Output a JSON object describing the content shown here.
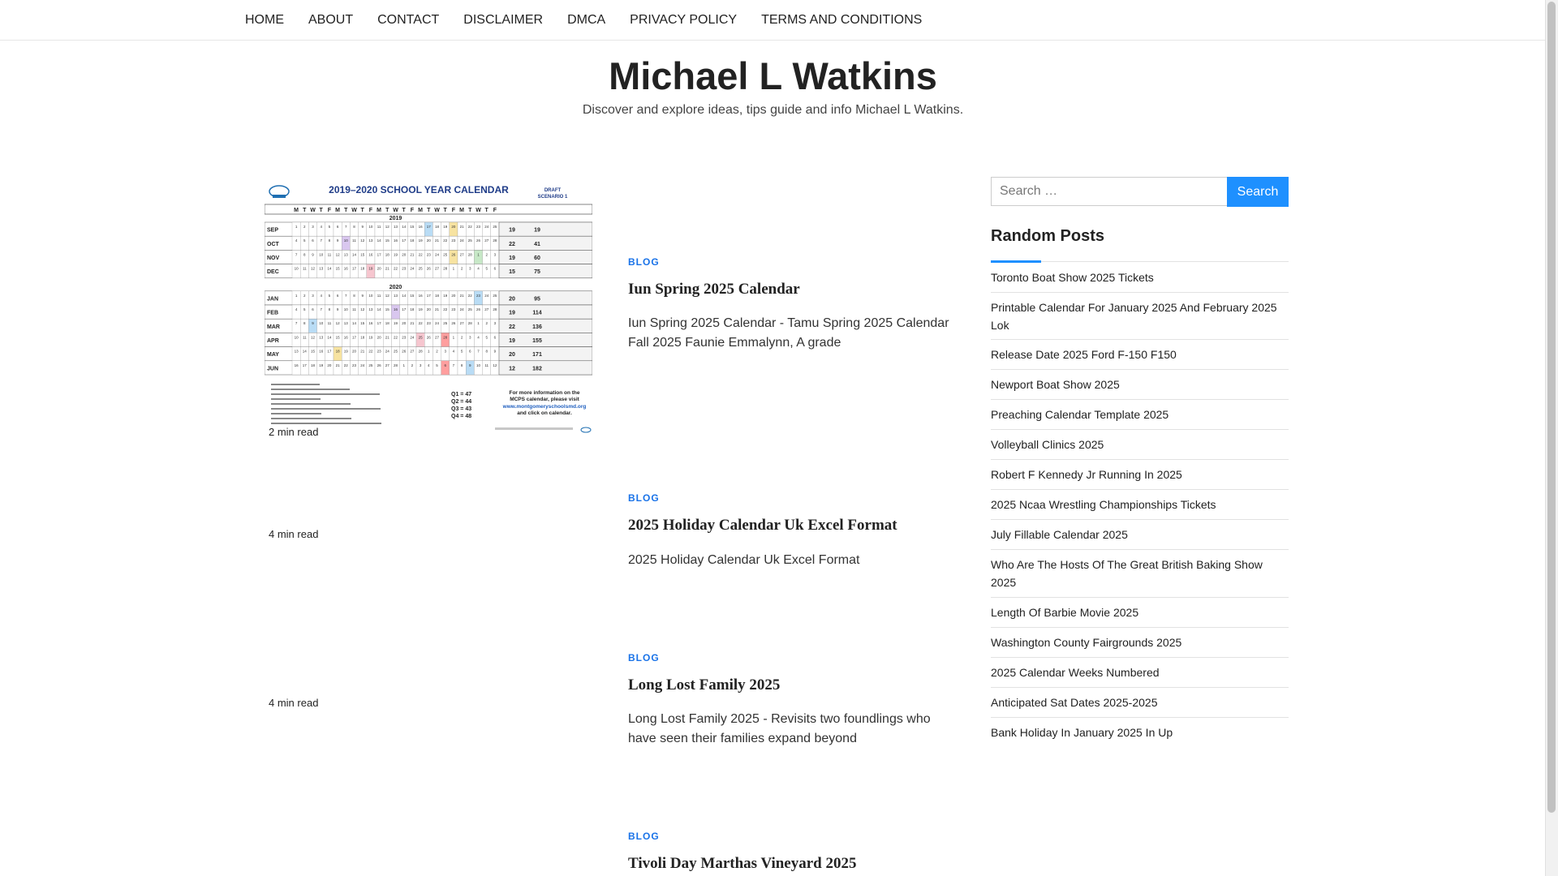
{
  "nav": {
    "items": [
      "HOME",
      "ABOUT",
      "CONTACT",
      "DISCLAIMER",
      "DMCA",
      "PRIVACY POLICY",
      "TERMS AND CONDITIONS"
    ]
  },
  "header": {
    "title": "Michael L Watkins",
    "description": "Discover and explore ideas, tips guide and info Michael L Watkins."
  },
  "posts": [
    {
      "category": "BLOG",
      "title": "Iun Spring 2025 Calendar",
      "excerpt": "Iun Spring 2025 Calendar - Tamu Spring 2025 Calendar Fall 2025 Faunie Emmalynn, A grade",
      "read_time": "2 min read"
    },
    {
      "category": "BLOG",
      "title": "2025 Holiday Calendar Uk Excel Format",
      "excerpt": "2025 Holiday Calendar Uk Excel Format",
      "read_time": "4 min read"
    },
    {
      "category": "BLOG",
      "title": "Long Lost Family 2025",
      "excerpt": "Long Lost Family 2025 - Revisits two foundlings who have seen their families expand beyond",
      "read_time": "4 min read"
    },
    {
      "category": "BLOG",
      "title": "Tivoli Day Marthas Vineyard 2025"
    }
  ],
  "thumbnail": {
    "heading": "2019–2020 SCHOOL YEAR CALENDAR",
    "draft": "DRAFT",
    "scenario": "SCENARIO 1",
    "year_a": "2019",
    "year_b": "2020",
    "months": [
      "SEP",
      "OCT",
      "NOV",
      "DEC",
      "JAN",
      "FEB",
      "MAR",
      "APR",
      "MAY",
      "JUN"
    ],
    "day_letters": [
      "M",
      "T",
      "W",
      "T",
      "F"
    ],
    "totals_a": [
      "19",
      "22",
      "19",
      "15"
    ],
    "totals_b": [
      "20",
      "19",
      "22",
      "19",
      "20",
      "12"
    ],
    "cumulative_a": [
      "19",
      "41",
      "60",
      "75"
    ],
    "cumulative_b": [
      "95",
      "114",
      "136",
      "155",
      "171",
      "182"
    ],
    "quarters": [
      "Q1 = 47",
      "Q2 = 44",
      "Q3 = 43",
      "Q4 = 48"
    ],
    "info_line1": "For more information on the",
    "info_line2": "MCPS calendar, please visit",
    "info_link": "www.montgomeryschoolsmd.org",
    "info_line3": "and click on calendar."
  },
  "sidebar": {
    "search_placeholder": "Search …",
    "search_button": "Search",
    "widget_title": "Random Posts",
    "random_posts": [
      "Toronto Boat Show 2025 Tickets",
      "Printable Calendar For January 2025 And February 2025 Lok",
      "Release Date 2025 Ford F-150 F150",
      "Newport Boat Show 2025",
      "Preaching Calendar Template 2025",
      "Volleyball Clinics 2025",
      "Robert F Kennedy Jr Running In 2025",
      "2025 Ncaa Wrestling Championships Tickets",
      "July Fillable Calendar 2025",
      "Who Are The Hosts Of The Great British Baking Show 2025",
      "Length Of Barbie Movie 2025",
      "Washington County Fairgrounds 2025",
      "2025 Calendar Weeks Numbered",
      "Anticipated Sat Dates 2025-2025",
      "Bank Holiday In January 2025 In Up"
    ]
  },
  "colors": {
    "accent": "#1e90ff",
    "category": "#1a73e8"
  }
}
